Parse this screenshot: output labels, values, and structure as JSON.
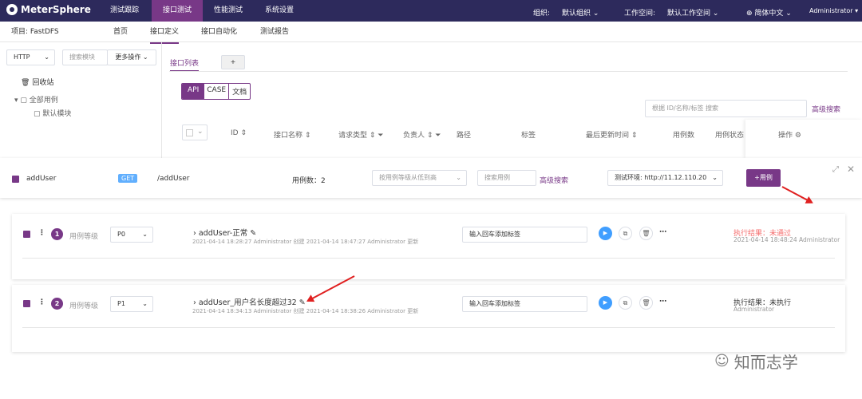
{
  "topbar": {
    "logo": "MeterSphere",
    "nav": [
      "测试跟踪",
      "接口测试",
      "性能测试",
      "系统设置"
    ],
    "org_label": "组织:",
    "org_value": "默认组织",
    "ws_label": "工作空间:",
    "ws_value": "默认工作空间",
    "lang": "简体中文",
    "user": "Administrator"
  },
  "subnav": {
    "project": "项目: FastDFS",
    "items": [
      "首页",
      "接口定义",
      "接口自动化",
      "测试报告"
    ]
  },
  "left": {
    "protocol": "HTTP",
    "search_placeholder": "搜索模块",
    "more": "更多操作",
    "recycle": "回收站",
    "all": "全部用例",
    "default": "默认模块"
  },
  "main": {
    "tab": "接口列表",
    "add": "+",
    "toggles": [
      "API",
      "CASE",
      "文档"
    ],
    "search_placeholder": "根据 ID/名称/标签 搜索",
    "advanced": "高级搜索",
    "columns": [
      "ID",
      "接口名称",
      "请求类型",
      "负责人",
      "路径",
      "标签",
      "最后更新时间",
      "用例数",
      "用例状态",
      "操作"
    ]
  },
  "case_header": {
    "name": "addUser",
    "method": "GET",
    "path": "/addUser",
    "count": "用例数：2",
    "priority_placeholder": "按用例等级从低到高",
    "search_placeholder": "搜索用例",
    "advanced": "高级搜索",
    "env": "测试环境: http://11.12.110.20",
    "add_case": "+用例"
  },
  "cases": [
    {
      "num": "1",
      "priority_label": "用例等级",
      "priority": "P0",
      "title": "addUser-正常",
      "meta": "2021-04-14 18:28:27 Administrator 创建    2021-04-14 18:47:27 Administrator 更新",
      "tag_placeholder": "输入回车添加标签",
      "result": "执行结果：未通过",
      "result_meta": "2021-04-14 18:48:24 Administrator",
      "result_color": "#f56c6c"
    },
    {
      "num": "2",
      "priority_label": "用例等级",
      "priority": "P1",
      "title": "addUser_用户名长度超过32",
      "meta": "2021-04-14 18:34:13 Administrator 创建    2021-04-14 18:38:26 Administrator 更新",
      "tag_placeholder": "输入回车添加标签",
      "result": "执行结果：未执行",
      "result_meta": "Administrator",
      "result_color": "#333333"
    }
  ],
  "watermark": "知而志学"
}
